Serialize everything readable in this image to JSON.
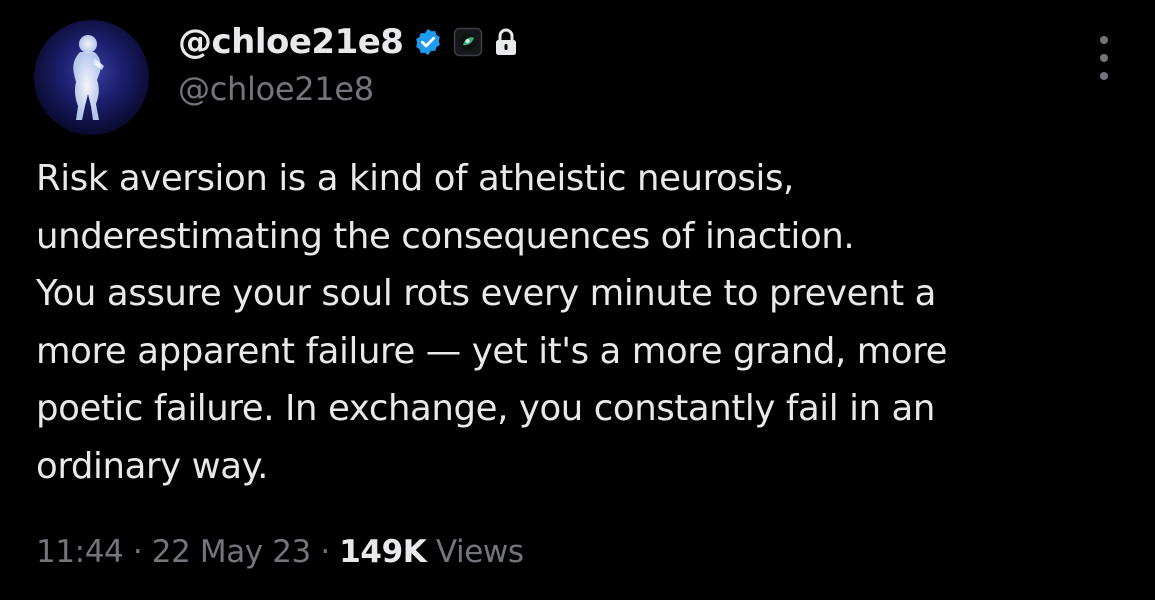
{
  "author": {
    "display_name": "@chloe21e8",
    "handle": "@chloe21e8",
    "verified_icon": "verified-badge-icon",
    "badges": [
      "verified-badge-icon",
      "affiliate-badge-icon",
      "lock-icon"
    ]
  },
  "tweet": {
    "lines": [
      "Risk aversion is a kind of atheistic neurosis,",
      "underestimating the consequences of inaction.",
      "You assure your soul rots every minute to prevent a",
      "more apparent failure — yet it's a more grand, more",
      "poetic failure. In exchange, you constantly fail in an",
      "ordinary way."
    ]
  },
  "meta": {
    "time": "11:44",
    "separator": "·",
    "date": "22 May 23",
    "views_count": "149K",
    "views_label": "Views"
  },
  "menu": {
    "icon": "more-options-icon"
  },
  "colors": {
    "background": "#000000",
    "text_primary": "#e7e9ea",
    "text_secondary": "#71767b",
    "verified_blue": "#1d9bf0"
  }
}
